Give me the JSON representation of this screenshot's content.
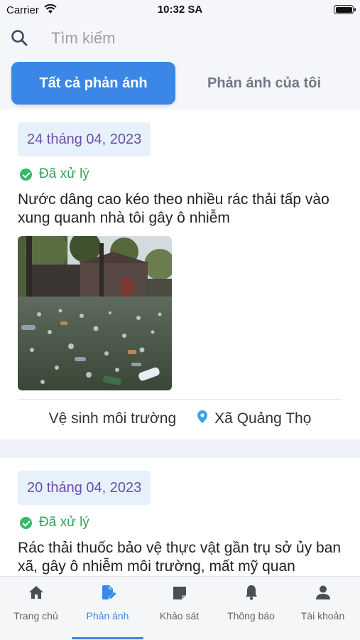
{
  "status_bar": {
    "carrier": "Carrier",
    "time": "10:32 SA"
  },
  "search": {
    "placeholder": "Tìm kiếm",
    "value": ""
  },
  "tabs": [
    {
      "label": "Tất cả phản ánh",
      "active": true
    },
    {
      "label": "Phản ánh của tôi",
      "active": false
    }
  ],
  "reports": [
    {
      "date": "24 tháng 04, 2023",
      "status": "Đã xử lý",
      "description": "Nước dâng cao kéo theo nhiều rác thải tấp vào xung quanh nhà tôi gây ô nhiễm",
      "category": "Vệ sinh môi trường",
      "location": "Xã Quảng Thọ"
    },
    {
      "date": "20 tháng 04, 2023",
      "status": "Đã xử lý",
      "description": "Rác thải thuốc bảo vệ thực vật gần trụ sở ủy ban xã, gây ô nhiễm môi trường, mất mỹ quan"
    }
  ],
  "bottom_nav": [
    {
      "label": "Trang chủ",
      "icon": "home-icon"
    },
    {
      "label": "Phản ánh",
      "icon": "edit-document-icon",
      "active": true
    },
    {
      "label": "Khảo sát",
      "icon": "survey-icon"
    },
    {
      "label": "Thông báo",
      "icon": "bell-icon"
    },
    {
      "label": "Tài khoản",
      "icon": "person-icon"
    }
  ],
  "colors": {
    "accent": "#3a87e8",
    "status_done": "#2fa45b",
    "date_text": "#6b4fa8",
    "date_bg": "#e6f1fb"
  }
}
